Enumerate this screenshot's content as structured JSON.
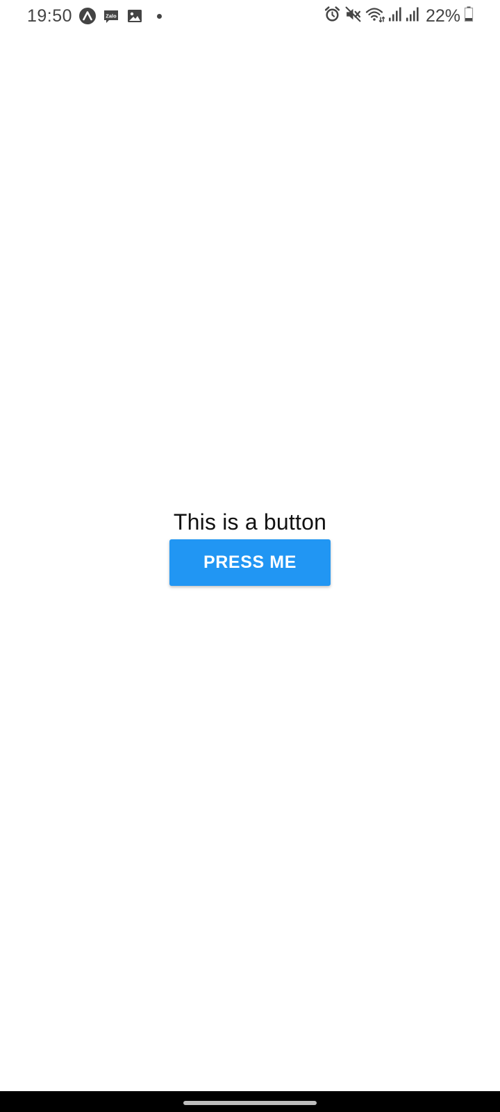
{
  "status_bar": {
    "time": "19:50",
    "battery_percent": "22%",
    "battery_level": 0.22,
    "notification_icons": [
      "expo-go-icon",
      "zalo-icon",
      "gallery-icon"
    ],
    "zalo_text": "Zalo",
    "system_icons": [
      "alarm-icon",
      "mute-icon",
      "wifi-icon",
      "signal-icon",
      "signal-icon",
      "battery-icon"
    ]
  },
  "main": {
    "caption": "This is a button",
    "button_label": "PRESS ME"
  },
  "colors": {
    "button_background": "#2196f3",
    "button_text": "#ffffff",
    "nav_bar": "#000000"
  }
}
